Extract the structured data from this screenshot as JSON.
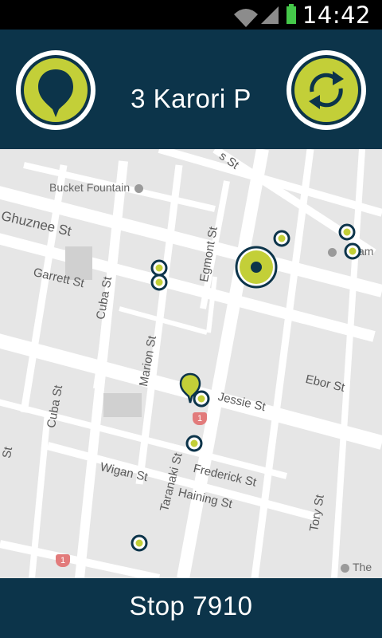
{
  "status_bar": {
    "time": "14:42",
    "icons": [
      "wifi-icon",
      "cell-signal-icon",
      "battery-icon"
    ],
    "battery_color": "#45c84a"
  },
  "header": {
    "route_title": "3 Karori P",
    "left_button_icon": "map-pin-icon",
    "right_button_icon": "refresh-icon",
    "background": "#0c344a",
    "accent": "#c3cf38"
  },
  "map": {
    "street_labels": {
      "ghuznee": "Ghuznee St",
      "garrett": "Garrett St",
      "cuba_upper": "Cuba St",
      "cuba_lower": "Cuba St",
      "marion": "Marion St",
      "egmont": "Egmont St",
      "jessie": "Jessie St",
      "ebor": "Ebor St",
      "frederick": "Frederick St",
      "wigan": "Wigan St",
      "haining": "Haining St",
      "taranaki": "Taranaki St",
      "tory": "Tory St",
      "partial_left": "St",
      "partial_top": "s St"
    },
    "poi_labels": {
      "bucket_fountain": "Bucket Fountain",
      "jam": "Jam",
      "the": "The"
    },
    "route_shields": [
      "1",
      "1"
    ]
  },
  "bottom_bar": {
    "stop_label": "Stop 7910"
  }
}
